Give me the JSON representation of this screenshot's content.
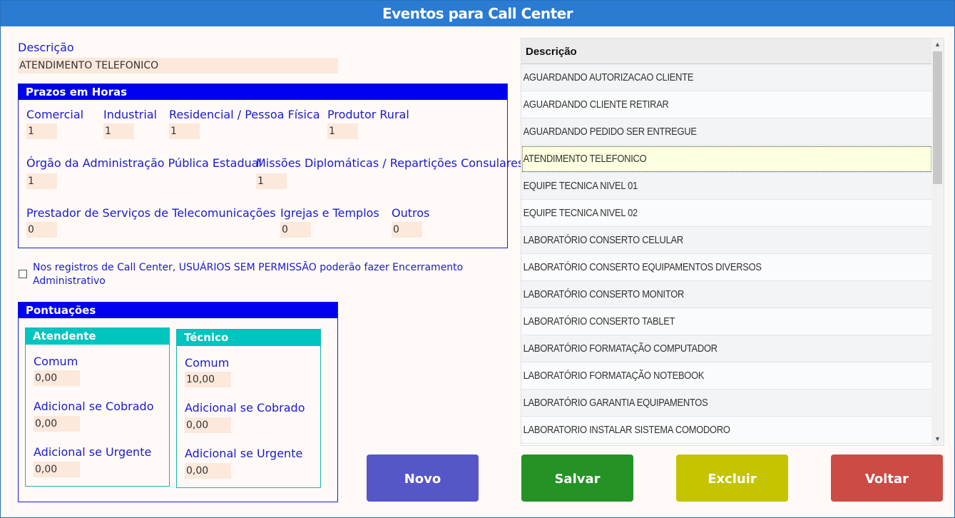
{
  "window": {
    "title": "Eventos para Call Center"
  },
  "descricao": {
    "label": "Descrição",
    "value": "ATENDIMENTO TELEFONICO"
  },
  "prazos": {
    "title": "Prazos em Horas",
    "comercial": {
      "label": "Comercial",
      "value": "1"
    },
    "industrial": {
      "label": "Industrial",
      "value": "1"
    },
    "residencial": {
      "label": "Residencial / Pessoa Física",
      "value": "1"
    },
    "produtor_rural": {
      "label": "Produtor Rural",
      "value": "1"
    },
    "orgao_publico": {
      "label": "Órgão da Administração Pública Estadual",
      "value": "1"
    },
    "missoes": {
      "label": "Missões Diplomáticas / Repartições Consulares",
      "value": "1"
    },
    "prestador": {
      "label": "Prestador de Serviços de Telecomunicações",
      "value": "0"
    },
    "igrejas": {
      "label": "Igrejas e Templos",
      "value": "0"
    },
    "outros": {
      "label": "Outros",
      "value": "0"
    }
  },
  "permissao": {
    "label": "Nos registros de Call Center, USUÁRIOS SEM PERMISSÃO poderão fazer Encerramento Administrativo",
    "checked": false
  },
  "pontuacoes": {
    "title": "Pontuações",
    "atendente": {
      "title": "Atendente",
      "comum": {
        "label": "Comum",
        "value": "0,00"
      },
      "cobrado": {
        "label": "Adicional se Cobrado",
        "value": "0,00"
      },
      "urgente": {
        "label": "Adicional se Urgente",
        "value": "0,00"
      }
    },
    "tecnico": {
      "title": "Técnico",
      "comum": {
        "label": "Comum",
        "value": "10,00"
      },
      "cobrado": {
        "label": "Adicional se Cobrado",
        "value": "0,00"
      },
      "urgente": {
        "label": "Adicional se Urgente",
        "value": "0,00"
      }
    }
  },
  "grid": {
    "header": "Descrição",
    "selected_index": 3,
    "rows": [
      "AGUARDANDO AUTORIZACAO CLIENTE",
      "AGUARDANDO CLIENTE RETIRAR",
      "AGUARDANDO PEDIDO SER ENTREGUE",
      "ATENDIMENTO TELEFONICO",
      "EQUIPE TECNICA NIVEL 01",
      "EQUIPE TECNICA NIVEL 02",
      "LABORATÓRIO CONSERTO CELULAR",
      "LABORATÓRIO CONSERTO EQUIPAMENTOS DIVERSOS",
      "LABORATÓRIO CONSERTO MONITOR",
      "LABORATÓRIO CONSERTO TABLET",
      "LABORATÓRIO FORMATAÇÃO COMPUTADOR",
      "LABORATÓRIO FORMATAÇÃO NOTEBOOK",
      "LABORATÓRIO GARANTIA EQUIPAMENTOS",
      "LABORATORIO INSTALAR SISTEMA COMODORO"
    ]
  },
  "buttons": {
    "novo": {
      "label": "Novo",
      "color": "#5656c8"
    },
    "salvar": {
      "label": "Salvar",
      "color": "#249224"
    },
    "excluir": {
      "label": "Excluir",
      "color": "#c4c400"
    },
    "voltar": {
      "label": "Voltar",
      "color": "#cc4b45"
    }
  }
}
